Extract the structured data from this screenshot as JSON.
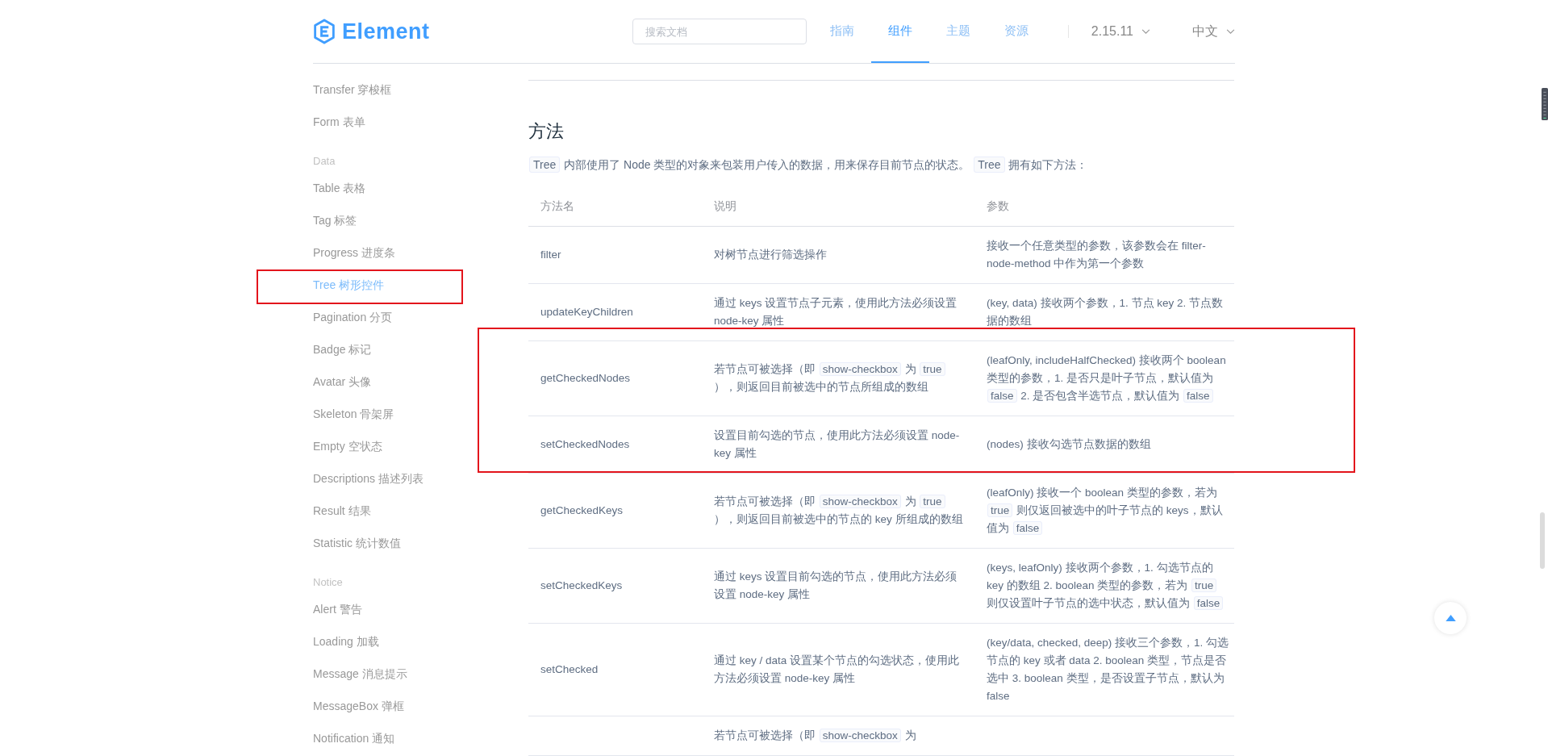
{
  "header": {
    "logo": "Element",
    "search": {
      "placeholder": "搜索文档"
    },
    "nav": [
      {
        "label": "指南",
        "selected": false
      },
      {
        "label": "组件",
        "selected": true
      },
      {
        "label": "主题",
        "selected": false
      },
      {
        "label": "资源",
        "selected": false
      }
    ],
    "version": "2.15.11",
    "language": "中文"
  },
  "sidebar": {
    "items": [
      {
        "kind": "item",
        "label": "Transfer 穿梭框",
        "selected": false,
        "highlighted": false
      },
      {
        "kind": "item",
        "label": "Form 表单",
        "selected": false,
        "highlighted": false
      },
      {
        "kind": "group",
        "label": "Data"
      },
      {
        "kind": "item",
        "label": "Table 表格",
        "selected": false,
        "highlighted": false
      },
      {
        "kind": "item",
        "label": "Tag 标签",
        "selected": false,
        "highlighted": false
      },
      {
        "kind": "item",
        "label": "Progress 进度条",
        "selected": false,
        "highlighted": false
      },
      {
        "kind": "item",
        "label": "Tree 树形控件",
        "selected": true,
        "highlighted": true
      },
      {
        "kind": "item",
        "label": "Pagination 分页",
        "selected": false,
        "highlighted": false
      },
      {
        "kind": "item",
        "label": "Badge 标记",
        "selected": false,
        "highlighted": false
      },
      {
        "kind": "item",
        "label": "Avatar 头像",
        "selected": false,
        "highlighted": false
      },
      {
        "kind": "item",
        "label": "Skeleton 骨架屏",
        "selected": false,
        "highlighted": false
      },
      {
        "kind": "item",
        "label": "Empty 空状态",
        "selected": false,
        "highlighted": false
      },
      {
        "kind": "item",
        "label": "Descriptions 描述列表",
        "selected": false,
        "highlighted": false
      },
      {
        "kind": "item",
        "label": "Result 结果",
        "selected": false,
        "highlighted": false
      },
      {
        "kind": "item",
        "label": "Statistic 统计数值",
        "selected": false,
        "highlighted": false
      },
      {
        "kind": "group",
        "label": "Notice"
      },
      {
        "kind": "item",
        "label": "Alert 警告",
        "selected": false,
        "highlighted": false
      },
      {
        "kind": "item",
        "label": "Loading 加载",
        "selected": false,
        "highlighted": false
      },
      {
        "kind": "item",
        "label": "Message 消息提示",
        "selected": false,
        "highlighted": false
      },
      {
        "kind": "item",
        "label": "MessageBox 弹框",
        "selected": false,
        "highlighted": false
      },
      {
        "kind": "item",
        "label": "Notification 通知",
        "selected": false,
        "highlighted": false
      }
    ]
  },
  "section": {
    "title": "方法",
    "intro": [
      {
        "text": "Tree",
        "code": true
      },
      {
        "text": " 内部使用了 Node 类型的对象来包装用户传入的数据，用来保存目前节点的状态。 ",
        "code": false
      },
      {
        "text": "Tree",
        "code": true
      },
      {
        "text": " 拥有如下方法：",
        "code": false
      }
    ],
    "table": {
      "columns": [
        "方法名",
        "说明",
        "参数"
      ],
      "rows": [
        {
          "name": "filter",
          "highlighted": false,
          "description": [
            {
              "text": "对树节点进行筛选操作",
              "code": false
            }
          ],
          "params": [
            {
              "text": "接收一个任意类型的参数，该参数会在 filter-node-method 中作为第一个参数",
              "code": false
            }
          ]
        },
        {
          "name": "updateKeyChildren",
          "highlighted": false,
          "description": [
            {
              "text": "通过 keys 设置节点子元素，使用此方法必须设置 node-key 属性",
              "code": false
            }
          ],
          "params": [
            {
              "text": "(key, data) 接收两个参数，1. 节点 key 2. 节点数据的数组",
              "code": false
            }
          ]
        },
        {
          "name": "getCheckedNodes",
          "highlighted": true,
          "description": [
            {
              "text": "若节点可被选择（即 ",
              "code": false
            },
            {
              "text": "show-checkbox",
              "code": true
            },
            {
              "text": " 为 ",
              "code": false
            },
            {
              "text": "true",
              "code": true
            },
            {
              "text": " ），则返回目前被选中的节点所组成的数组",
              "code": false
            }
          ],
          "params": [
            {
              "text": "(leafOnly, includeHalfChecked) 接收两个 boolean 类型的参数，1. 是否只是叶子节点，默认值为 ",
              "code": false
            },
            {
              "text": "false",
              "code": true
            },
            {
              "text": " 2. 是否包含半选节点，默认值为 ",
              "code": false
            },
            {
              "text": "false",
              "code": true
            }
          ]
        },
        {
          "name": "setCheckedNodes",
          "highlighted": true,
          "description": [
            {
              "text": "设置目前勾选的节点，使用此方法必须设置 node-key 属性",
              "code": false
            }
          ],
          "params": [
            {
              "text": "(nodes) 接收勾选节点数据的数组",
              "code": false
            }
          ]
        },
        {
          "name": "getCheckedKeys",
          "highlighted": false,
          "description": [
            {
              "text": "若节点可被选择（即 ",
              "code": false
            },
            {
              "text": "show-checkbox",
              "code": true
            },
            {
              "text": " 为 ",
              "code": false
            },
            {
              "text": "true",
              "code": true
            },
            {
              "text": " ），则返回目前被选中的节点的 key 所组成的数组",
              "code": false
            }
          ],
          "params": [
            {
              "text": "(leafOnly) 接收一个 boolean 类型的参数，若为 ",
              "code": false
            },
            {
              "text": "true",
              "code": true
            },
            {
              "text": " 则仅返回被选中的叶子节点的 keys，默认值为 ",
              "code": false
            },
            {
              "text": "false",
              "code": true
            }
          ]
        },
        {
          "name": "setCheckedKeys",
          "highlighted": false,
          "description": [
            {
              "text": "通过 keys 设置目前勾选的节点，使用此方法必须设置 node-key 属性",
              "code": false
            }
          ],
          "params": [
            {
              "text": "(keys, leafOnly) 接收两个参数，1. 勾选节点的 key 的数组 2. boolean 类型的参数，若为 ",
              "code": false
            },
            {
              "text": "true",
              "code": true
            },
            {
              "text": " 则仅设置叶子节点的选中状态，默认值为 ",
              "code": false
            },
            {
              "text": "false",
              "code": true
            }
          ]
        },
        {
          "name": "setChecked",
          "highlighted": false,
          "description": [
            {
              "text": "通过 key / data 设置某个节点的勾选状态，使用此方法必须设置 node-key 属性",
              "code": false
            }
          ],
          "params": [
            {
              "text": "(key/data, checked, deep) 接收三个参数，1. 勾选节点的 key 或者 data 2. boolean 类型，节点是否选中 3. boolean 类型，是否设置子节点，默认为 false",
              "code": false
            }
          ]
        },
        {
          "highlighted": false,
          "description": [
            {
              "text": "若节点可被选择（即 ",
              "code": false
            },
            {
              "text": "show-checkbox",
              "code": true
            },
            {
              "text": " 为",
              "code": false
            }
          ]
        }
      ]
    }
  }
}
